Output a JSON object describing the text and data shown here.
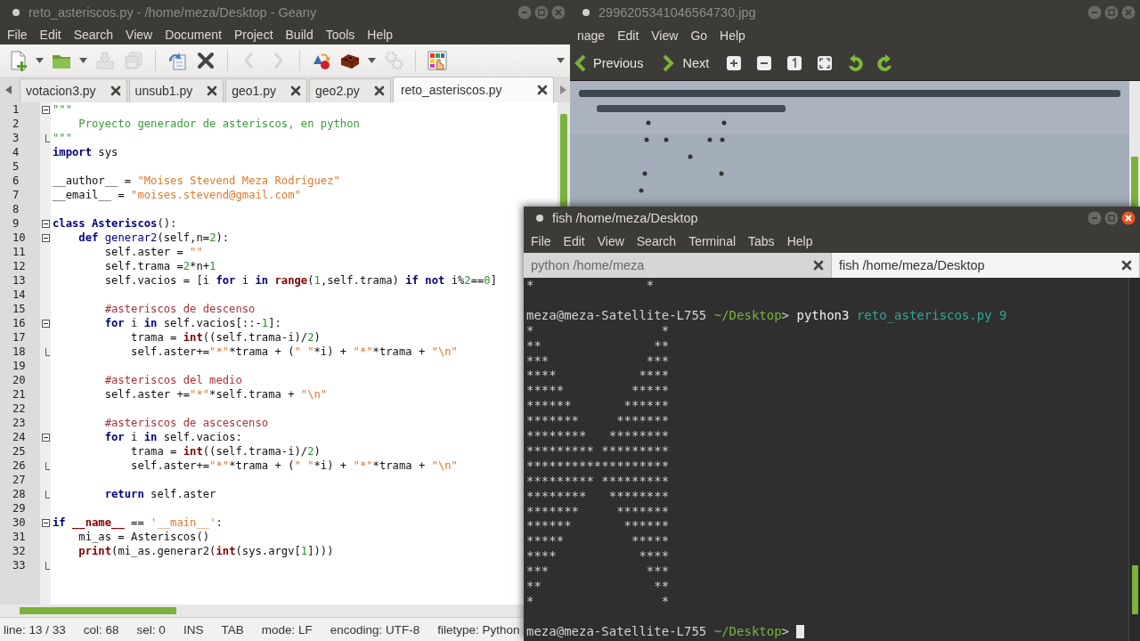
{
  "geany": {
    "window": {
      "title": "reto_asteriscos.py - /home/meza/Desktop - Geany",
      "active": false
    },
    "menu": [
      "File",
      "Edit",
      "Search",
      "View",
      "Document",
      "Project",
      "Build",
      "Tools",
      "Help"
    ],
    "toolbar": [
      {
        "kind": "new",
        "disabled": false,
        "dropdown": true
      },
      {
        "kind": "open",
        "disabled": false,
        "dropdown": true
      },
      {
        "kind": "save",
        "disabled": true,
        "dropdown": false
      },
      {
        "kind": "save_all",
        "disabled": true,
        "dropdown": false
      },
      {
        "kind": "sep"
      },
      {
        "kind": "reload",
        "disabled": false,
        "dropdown": false
      },
      {
        "kind": "close",
        "disabled": false,
        "dropdown": false
      },
      {
        "kind": "sep"
      },
      {
        "kind": "back",
        "disabled": true,
        "dropdown": false
      },
      {
        "kind": "forward",
        "disabled": true,
        "dropdown": false
      },
      {
        "kind": "sep"
      },
      {
        "kind": "compile",
        "disabled": false,
        "dropdown": false
      },
      {
        "kind": "build",
        "disabled": false,
        "dropdown": true
      },
      {
        "kind": "execute",
        "disabled": true,
        "dropdown": false
      },
      {
        "kind": "sep"
      },
      {
        "kind": "color",
        "disabled": false,
        "dropdown": false
      }
    ],
    "tabs": [
      {
        "label": "votacion3.py",
        "selected": false
      },
      {
        "label": "unsub1.py",
        "selected": false
      },
      {
        "label": "geo1.py",
        "selected": false
      },
      {
        "label": "geo2.py",
        "selected": false
      },
      {
        "label": "reto_asteriscos.py",
        "selected": true
      }
    ],
    "lines": [
      {
        "number": "1",
        "kind": "fold_open",
        "tokens": [
          {
            "kind": "doc",
            "text": "\"\"\""
          }
        ]
      },
      {
        "number": "2",
        "kind": "plain",
        "tokens": [
          {
            "kind": "doc",
            "text": "    Proyecto generador de asteriscos, en python"
          }
        ]
      },
      {
        "number": "3",
        "kind": "fold_end",
        "tokens": [
          {
            "kind": "doc",
            "text": "\"\"\""
          }
        ]
      },
      {
        "number": "4",
        "kind": "plain",
        "tokens": [
          {
            "kind": "kw",
            "text": "import"
          },
          {
            "kind": "p",
            "text": " sys"
          }
        ]
      },
      {
        "number": "5",
        "kind": "plain"
      },
      {
        "number": "6",
        "kind": "plain",
        "tokens": [
          {
            "kind": "p",
            "text": "__author__ = "
          },
          {
            "kind": "str",
            "text": "\"Moises Stevend Meza Rodriguez\""
          }
        ]
      },
      {
        "number": "7",
        "kind": "plain",
        "tokens": [
          {
            "kind": "p",
            "text": "__email__ = "
          },
          {
            "kind": "str",
            "text": "\"moises.stevend@gmail.com\""
          }
        ]
      },
      {
        "number": "8",
        "kind": "plain"
      },
      {
        "number": "9",
        "kind": "fold_open",
        "tokens": [
          {
            "kind": "kw",
            "text": "class"
          },
          {
            "kind": "kw",
            "text": " Asteriscos"
          },
          {
            "kind": "p",
            "text": "():"
          }
        ]
      },
      {
        "number": "10",
        "kind": "fold_open",
        "tokens": [
          {
            "kind": "kw",
            "text": "    def"
          },
          {
            "kind": "fn",
            "text": " generar2"
          },
          {
            "kind": "p",
            "text": "(self,n="
          },
          {
            "kind": "num",
            "text": "2"
          },
          {
            "kind": "p",
            "text": "):"
          }
        ]
      },
      {
        "number": "11",
        "kind": "plain",
        "tokens": [
          {
            "kind": "p",
            "text": "        self.aster = "
          },
          {
            "kind": "str",
            "text": "\"\""
          }
        ]
      },
      {
        "number": "12",
        "kind": "plain",
        "tokens": [
          {
            "kind": "p",
            "text": "        self.trama ="
          },
          {
            "kind": "num",
            "text": "2"
          },
          {
            "kind": "p",
            "text": "*n+"
          },
          {
            "kind": "num",
            "text": "1"
          }
        ]
      },
      {
        "number": "13",
        "kind": "plain",
        "tokens": [
          {
            "kind": "p",
            "text": "        self.vacios = [i "
          },
          {
            "kind": "kw",
            "text": "for"
          },
          {
            "kind": "p",
            "text": " i "
          },
          {
            "kind": "kw",
            "text": "in"
          },
          {
            "kind": "bi",
            "text": " range"
          },
          {
            "kind": "p",
            "text": "("
          },
          {
            "kind": "num",
            "text": "1"
          },
          {
            "kind": "p",
            "text": ",self.trama) "
          },
          {
            "kind": "kw",
            "text": "if"
          },
          {
            "kind": "kw",
            "text": " not"
          },
          {
            "kind": "p",
            "text": " i%"
          },
          {
            "kind": "num",
            "text": "2"
          },
          {
            "kind": "p",
            "text": "=="
          },
          {
            "kind": "num",
            "text": "0"
          },
          {
            "kind": "p",
            "text": "]"
          }
        ]
      },
      {
        "number": "14",
        "kind": "plain"
      },
      {
        "number": "15",
        "kind": "plain",
        "tokens": [
          {
            "kind": "cm",
            "text": "        #asteriscos de descenso"
          }
        ]
      },
      {
        "number": "16",
        "kind": "fold_open",
        "tokens": [
          {
            "kind": "kw",
            "text": "        for"
          },
          {
            "kind": "p",
            "text": " i "
          },
          {
            "kind": "kw",
            "text": "in"
          },
          {
            "kind": "p",
            "text": " self.vacios[::-"
          },
          {
            "kind": "num",
            "text": "1"
          },
          {
            "kind": "p",
            "text": "]:"
          }
        ]
      },
      {
        "number": "17",
        "kind": "plain",
        "tokens": [
          {
            "kind": "p",
            "text": "            trama = "
          },
          {
            "kind": "bi",
            "text": "int"
          },
          {
            "kind": "p",
            "text": "((self.trama-i)/"
          },
          {
            "kind": "num",
            "text": "2"
          },
          {
            "kind": "p",
            "text": ")"
          }
        ]
      },
      {
        "number": "18",
        "kind": "fold_end",
        "tokens": [
          {
            "kind": "p",
            "text": "            self.aster+="
          },
          {
            "kind": "str",
            "text": "\"*\""
          },
          {
            "kind": "p",
            "text": "*trama + ("
          },
          {
            "kind": "str",
            "text": "\" \""
          },
          {
            "kind": "p",
            "text": "*i) + "
          },
          {
            "kind": "str",
            "text": "\"*\""
          },
          {
            "kind": "p",
            "text": "*trama + "
          },
          {
            "kind": "str",
            "text": "\"\\n\""
          }
        ]
      },
      {
        "number": "19",
        "kind": "plain"
      },
      {
        "number": "20",
        "kind": "plain",
        "tokens": [
          {
            "kind": "cm",
            "text": "        #asteriscos del medio"
          }
        ]
      },
      {
        "number": "21",
        "kind": "plain",
        "tokens": [
          {
            "kind": "p",
            "text": "        self.aster +="
          },
          {
            "kind": "str",
            "text": "\"*\""
          },
          {
            "kind": "p",
            "text": "*self.trama + "
          },
          {
            "kind": "str",
            "text": "\"\\n\""
          }
        ]
      },
      {
        "number": "22",
        "kind": "plain"
      },
      {
        "number": "23",
        "kind": "plain",
        "tokens": [
          {
            "kind": "cm",
            "text": "        #asteriscos de ascescenso"
          }
        ]
      },
      {
        "number": "24",
        "kind": "fold_open",
        "tokens": [
          {
            "kind": "kw",
            "text": "        for"
          },
          {
            "kind": "p",
            "text": " i "
          },
          {
            "kind": "kw",
            "text": "in"
          },
          {
            "kind": "p",
            "text": " self.vacios:"
          }
        ]
      },
      {
        "number": "25",
        "kind": "plain",
        "tokens": [
          {
            "kind": "p",
            "text": "            trama = "
          },
          {
            "kind": "bi",
            "text": "int"
          },
          {
            "kind": "p",
            "text": "((self.trama-i)/"
          },
          {
            "kind": "num",
            "text": "2"
          },
          {
            "kind": "p",
            "text": ")"
          }
        ]
      },
      {
        "number": "26",
        "kind": "fold_end",
        "tokens": [
          {
            "kind": "p",
            "text": "            self.aster+="
          },
          {
            "kind": "str",
            "text": "\"*\""
          },
          {
            "kind": "p",
            "text": "*trama + ("
          },
          {
            "kind": "str",
            "text": "\" \""
          },
          {
            "kind": "p",
            "text": "*i) + "
          },
          {
            "kind": "str",
            "text": "\"*\""
          },
          {
            "kind": "p",
            "text": "*trama + "
          },
          {
            "kind": "str",
            "text": "\"\\n\""
          }
        ]
      },
      {
        "number": "27",
        "kind": "plain"
      },
      {
        "number": "28",
        "kind": "fold_end",
        "tokens": [
          {
            "kind": "kw",
            "text": "        return"
          },
          {
            "kind": "p",
            "text": " self.aster"
          }
        ]
      },
      {
        "number": "29",
        "kind": "plain"
      },
      {
        "number": "30",
        "kind": "fold_open",
        "tokens": [
          {
            "kind": "kw",
            "text": "if"
          },
          {
            "kind": "bi",
            "text": " __name__"
          },
          {
            "kind": "p",
            "text": " == "
          },
          {
            "kind": "str",
            "text": "'__main__'"
          },
          {
            "kind": "p",
            "text": ":"
          }
        ]
      },
      {
        "number": "31",
        "kind": "plain",
        "tokens": [
          {
            "kind": "p",
            "text": "    mi_as = Asteriscos()"
          }
        ]
      },
      {
        "number": "32",
        "kind": "plain",
        "tokens": [
          {
            "kind": "bi",
            "text": "    print"
          },
          {
            "kind": "p",
            "text": "(mi_as.generar2("
          },
          {
            "kind": "bi",
            "text": "int"
          },
          {
            "kind": "p",
            "text": "(sys.argv["
          },
          {
            "kind": "num",
            "text": "1"
          },
          {
            "kind": "p",
            "text": "])))"
          }
        ]
      },
      {
        "number": "33",
        "kind": "fold_end"
      }
    ],
    "status": [
      "line: 13 / 33",
      "col: 68",
      "sel: 0",
      "INS",
      "TAB",
      "mode: LF",
      "encoding: UTF-8",
      "filetype: Python"
    ]
  },
  "viewer": {
    "window": {
      "title": "2996205341046564730.jpg",
      "active": false
    },
    "menu": [
      "nage",
      "Edit",
      "View",
      "Go",
      "Help"
    ],
    "toolbar": [
      {
        "kind": "previous",
        "label": "Previous"
      },
      {
        "kind": "next",
        "label": "Next"
      },
      {
        "kind": "zoom_in"
      },
      {
        "kind": "zoom_out"
      },
      {
        "kind": "actual_size"
      },
      {
        "kind": "fit"
      },
      {
        "kind": "rotate_left"
      },
      {
        "kind": "rotate_right"
      }
    ],
    "image": {
      "kind": "picture"
    }
  },
  "terminal": {
    "window": {
      "title": "fish /home/meza/Desktop",
      "active": true
    },
    "menu": [
      "File",
      "Edit",
      "View",
      "Search",
      "Terminal",
      "Tabs",
      "Help"
    ],
    "tabs": [
      {
        "label": "python /home/meza",
        "selected": false
      },
      {
        "label": "fish /home/meza/Desktop",
        "selected": true
      }
    ],
    "lines": [
      {
        "kind": "output",
        "text": "*               *"
      },
      {
        "kind": "blank"
      },
      {
        "kind": "prompt",
        "user_host": "meza@meza-Satellite-L755",
        "cwd": "~/Desktop",
        "symbol": ">",
        "command": "python3",
        "args": "reto_asteriscos.py 9",
        "cursor": false
      },
      {
        "kind": "output",
        "text": "*                 *\n**               **\n***             ***\n****           ****\n*****         *****\n******       ******\n*******     *******\n********   ********\n********* *********\n*******************\n********* *********\n********   ********\n*******     *******\n******       ******\n*****         *****\n****           ****\n***             ***\n**               **\n*                 *"
      },
      {
        "kind": "blank"
      },
      {
        "kind": "prompt",
        "user_host": "meza@meza-Satellite-L755",
        "cwd": "~/Desktop",
        "symbol": ">",
        "cursor": true
      }
    ]
  }
}
